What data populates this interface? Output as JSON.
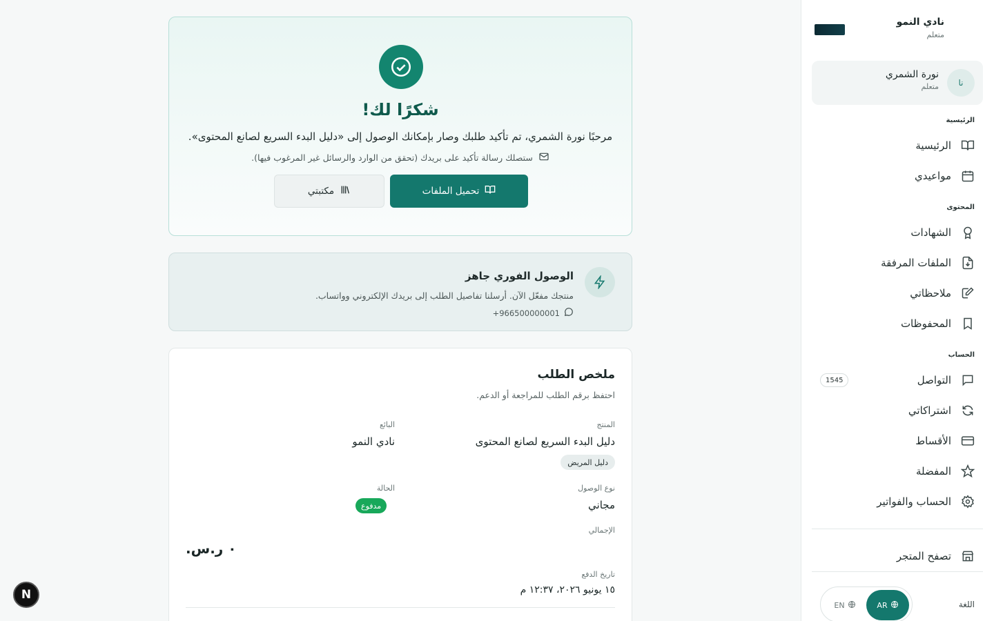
{
  "sidebar": {
    "brand": {
      "name": "نادي النمو",
      "role": "متعلم"
    },
    "user": {
      "initials": "نا",
      "name": "نورة الشمري",
      "role": "متعلم"
    },
    "sections": {
      "home": "الرئيسية",
      "content": "المحتوى",
      "account": "الحساب"
    },
    "items": [
      {
        "label": "الرئيسية",
        "icon": "book-open-icon"
      },
      {
        "label": "مواعيدي",
        "icon": "calendar-icon"
      },
      {
        "label": "الشهادات",
        "icon": "award-icon"
      },
      {
        "label": "الملفات المرفقة",
        "icon": "file-download-icon"
      },
      {
        "label": "ملاحظاتي",
        "icon": "edit-note-icon"
      },
      {
        "label": "المحفوظات",
        "icon": "bookmark-icon"
      },
      {
        "label": "التواصل",
        "icon": "message-icon",
        "badge": "1545"
      },
      {
        "label": "اشتراكاتي",
        "icon": "refresh-icon"
      },
      {
        "label": "الأقساط",
        "icon": "credit-card-icon"
      },
      {
        "label": "المفضلة",
        "icon": "star-icon"
      },
      {
        "label": "الحساب والفواتير",
        "icon": "settings-icon"
      }
    ],
    "browse_store": "تصفح المتجر",
    "language": {
      "label": "اللغة",
      "ar": "AR",
      "en": "EN"
    }
  },
  "thanks": {
    "title": "شكرًا لك!",
    "message": "مرحبًا نورة الشمري، تم تأكيد طلبك وصار بإمكانك الوصول إلى «دليل البدء السريع لصانع المحتوى».",
    "email_note": "ستصلك رسالة تأكيد على بريدك (تحقق من الوارد والرسائل غير المرغوب فيها).",
    "download_button": "تحميل الملفات",
    "library_button": "مكتبتي"
  },
  "access": {
    "title": "الوصول الفوري جاهز",
    "description": "منتجك مفعّل الآن. أرسلنا تفاصيل الطلب إلى بريدك الإلكتروني وواتساب.",
    "phone": "+966500000001"
  },
  "summary": {
    "title": "ملخص الطلب",
    "subtitle": "احتفظ برقم الطلب للمراجعة أو الدعم.",
    "product_label": "المنتج",
    "product_value": "دليل البدء السريع لصانع المحتوى",
    "product_tag": "دليل المريض",
    "seller_label": "البائع",
    "seller_value": "نادي النمو",
    "access_type_label": "نوع الوصول",
    "access_type_value": "مجاني",
    "status_label": "الحالة",
    "status_value": "مدفوع",
    "total_label": "الإجمالي",
    "total_value": "٠ ر.س.",
    "payment_date_label": "تاريخ الدفع",
    "payment_date_value": "١٥ يونيو ٢٠٢٦، ١٢:٣٧ م"
  },
  "dev_badge": "N"
}
